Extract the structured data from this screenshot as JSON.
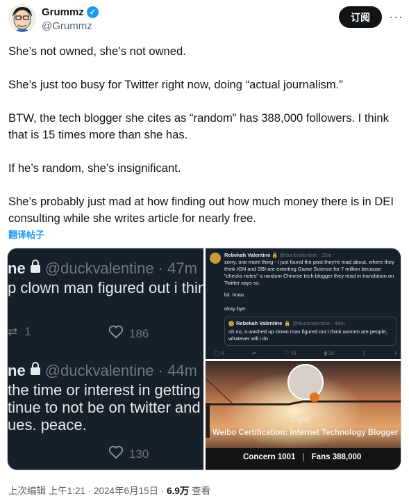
{
  "author": {
    "name": "Grummz",
    "handle": "@Grummz"
  },
  "follow_label": "订阅",
  "more_label": "···",
  "paragraphs": [
    "She’s not owned, she’s not owned.",
    "She’s just too busy for Twitter right now, doing “actual journalism.”",
    "BTW, the tech blogger she cites as “random” has 388,000 followers. I think that is 15 times more than she has.",
    "If he’s random, she’s insignificant.",
    "She’s probably just mad at how finding out how much money there is in DEI consulting while she writes article for nearly free."
  ],
  "translate_label": "翻译帖子",
  "media": {
    "left": {
      "tweet1": {
        "name_part": "ne",
        "handle_time": "@duckvalentine · 47m",
        "text": "p clown man figured out i think w",
        "retweets": "1",
        "likes": "186"
      },
      "tweet2": {
        "name_part": "ne",
        "handle_time": "@duckvalentine · 44m",
        "line1": "the time or interest in getting into",
        "line2": "tinue to not be on twitter and do",
        "line3": "ues. peace.",
        "likes": "130"
      }
    },
    "top_right": {
      "name": "Rebekah Valentine",
      "handle_time": "@duckvalentine · 15m",
      "text": "sorry, one more thing - i just found the post they're mad about, where they think IGN and SBI are extorting Game Science for 7 million because \"checks notes\" a random Chinese tech blogger they read in translation on Twitter says so.",
      "line_lol": "lol. lmao.",
      "line_bye": "okay bye.",
      "quote": {
        "name": "Rebekah Valentine",
        "handle_time": "@duckvalentine · 48m",
        "text": "oh no, a washed up clown man figured out i think women are people, whatever will i do"
      },
      "stats": {
        "replies": "5",
        "likes": "70",
        "views": "2K"
      }
    },
    "bottom_right": {
      "name": "Tiger",
      "cert": "Weibo Certification: Internet Technology Blogger",
      "concern": "Concern 1001",
      "fans": "Fans 388,000"
    }
  },
  "footer": {
    "prefix": "上次编辑 上午1:21 · 2024年6月15日 · ",
    "views": "6.9万",
    "suffix": " 查看"
  }
}
